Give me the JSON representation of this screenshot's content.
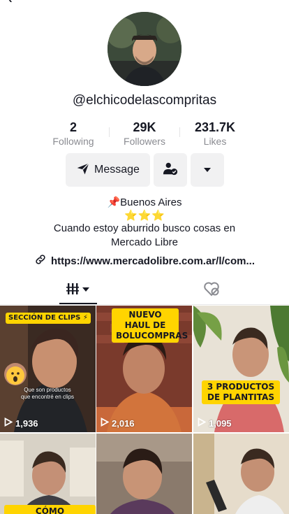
{
  "profile": {
    "username": "@elchicodelascompritas",
    "stats": [
      {
        "value": "2",
        "label": "Following"
      },
      {
        "value": "29K",
        "label": "Followers"
      },
      {
        "value": "231.7K",
        "label": "Likes"
      }
    ],
    "buttons": {
      "message_label": "Message",
      "follow_icon": "person-check-icon",
      "more_icon": "triangle-down-icon"
    },
    "bio": {
      "location": "📌Buenos Aires",
      "stars": [
        "⭐",
        "⭐",
        "⭐"
      ],
      "line1": "Cuando estoy aburrido busco cosas en",
      "line2": "Mercado Libre"
    },
    "link": "https://www.mercadolibre.com.ar/l/com..."
  },
  "tabs": {
    "videos_icon": "grid-bars-icon",
    "liked_icon": "heart-hidden-icon"
  },
  "videos": [
    {
      "views": "1,936",
      "tag": "SECCIÓN DE CLIPS ⚡",
      "caption": "Que son productos que encontré en clips"
    },
    {
      "views": "2,016",
      "tag": "NUEVO HAUL DE BOLUCOMPRAS",
      "caption": ""
    },
    {
      "views": "1,095",
      "tag": "3 PRODUCTOS DE PLANTITAS",
      "caption": ""
    },
    {
      "views": "",
      "tag": "CÓMO APROVECHAR",
      "caption": ""
    },
    {
      "views": "",
      "tag": "",
      "caption": ""
    },
    {
      "views": "",
      "tag": "",
      "caption": ""
    }
  ],
  "colors": {
    "text": "#161823",
    "muted": "#8a8b91",
    "button_bg": "#f1f1f2",
    "tag_yellow": "#ffd400"
  }
}
